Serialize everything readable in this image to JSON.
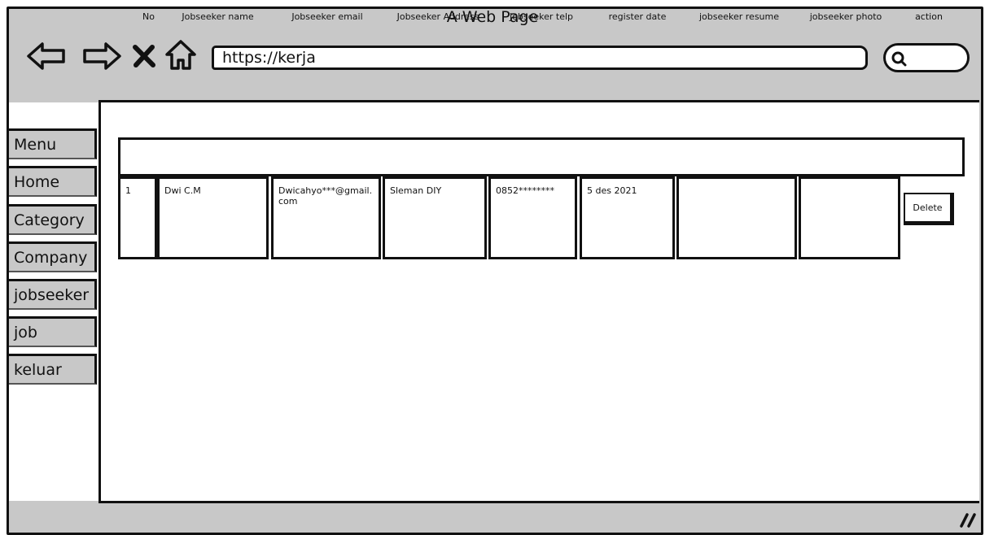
{
  "window": {
    "title": "A Web Page"
  },
  "browser": {
    "url": "https://kerja",
    "icons": [
      "back-arrow-icon",
      "forward-arrow-icon",
      "close-icon",
      "home-icon",
      "search-icon",
      "resize-grip-icon"
    ]
  },
  "sidebar": {
    "items": [
      {
        "label": "Menu"
      },
      {
        "label": "Home"
      },
      {
        "label": "Category"
      },
      {
        "label": "Company"
      },
      {
        "label": "jobseeker"
      },
      {
        "label": "job"
      },
      {
        "label": "keluar"
      }
    ]
  },
  "table": {
    "headers": [
      "No",
      "Jobseeker name",
      "Jobseeker email",
      "Jobseeker Address",
      "Jobseeker telp",
      "register date",
      "jobseeker resume",
      "jobseeker photo",
      "action"
    ],
    "rows": [
      {
        "no": "1",
        "name": "Dwi C.M",
        "email": "Dwicahyo***@gmail.com",
        "address": "Sleman DIY",
        "telp": "0852********",
        "date": "5 des 2021",
        "resume": "",
        "photo": "",
        "action": "Delete"
      }
    ]
  },
  "colors": {
    "chrome": "#c8c8c8",
    "stroke": "#111111",
    "background": "#ffffff"
  }
}
